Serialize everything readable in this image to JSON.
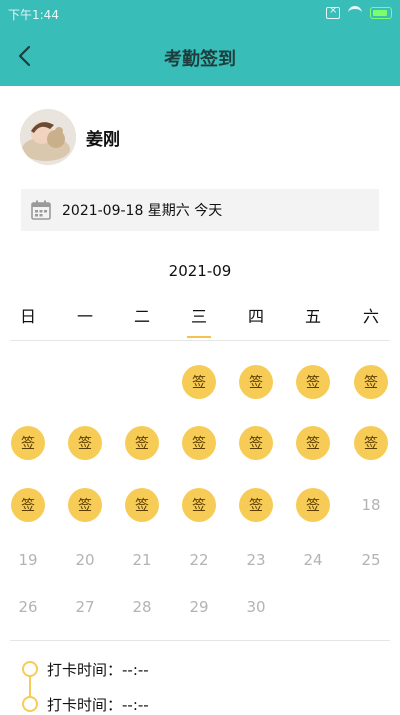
{
  "status_bar": {
    "time": "下午1:44"
  },
  "header": {
    "title": "考勤签到"
  },
  "profile": {
    "name": "姜刚"
  },
  "date_bar": {
    "text": "2021-09-18 星期六 今天"
  },
  "calendar": {
    "month": "2021-09",
    "weekdays": [
      "日",
      "一",
      "二",
      "三",
      "四",
      "五",
      "六"
    ],
    "selected_weekday_index": 3,
    "sign_label": "签",
    "rows": [
      [
        {
          "type": "empty"
        },
        {
          "type": "empty"
        },
        {
          "type": "empty"
        },
        {
          "type": "sign"
        },
        {
          "type": "sign"
        },
        {
          "type": "sign"
        },
        {
          "type": "sign"
        }
      ],
      [
        {
          "type": "sign"
        },
        {
          "type": "sign"
        },
        {
          "type": "sign"
        },
        {
          "type": "sign"
        },
        {
          "type": "sign"
        },
        {
          "type": "sign"
        },
        {
          "type": "sign"
        }
      ],
      [
        {
          "type": "sign"
        },
        {
          "type": "sign"
        },
        {
          "type": "sign"
        },
        {
          "type": "sign"
        },
        {
          "type": "sign"
        },
        {
          "type": "sign"
        },
        {
          "type": "day",
          "label": "18"
        }
      ],
      [
        {
          "type": "day",
          "label": "19"
        },
        {
          "type": "day",
          "label": "20"
        },
        {
          "type": "day",
          "label": "21"
        },
        {
          "type": "day",
          "label": "22"
        },
        {
          "type": "day",
          "label": "23"
        },
        {
          "type": "day",
          "label": "24"
        },
        {
          "type": "day",
          "label": "25"
        }
      ],
      [
        {
          "type": "day",
          "label": "26"
        },
        {
          "type": "day",
          "label": "27"
        },
        {
          "type": "day",
          "label": "28"
        },
        {
          "type": "day",
          "label": "29"
        },
        {
          "type": "day",
          "label": "30"
        },
        {
          "type": "empty"
        },
        {
          "type": "empty"
        }
      ]
    ]
  },
  "punch_records": [
    {
      "label": "打卡时间：--:--"
    },
    {
      "label": "打卡时间：--:--"
    }
  ],
  "colors": {
    "header_bg": "#38bdb8",
    "sign_bg": "#f7cc56"
  }
}
